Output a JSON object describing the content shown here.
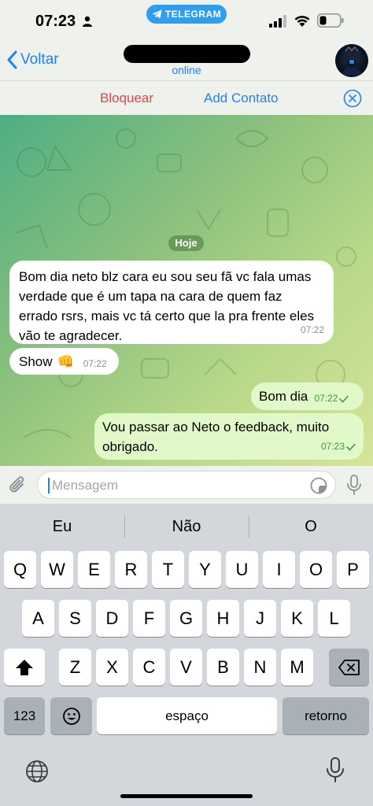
{
  "status": {
    "time": "07:23",
    "app_pill": "TELEGRAM"
  },
  "header": {
    "back_label": "Voltar",
    "status_text": "online"
  },
  "actions": {
    "block_label": "Bloquear",
    "add_contact_label": "Add Contato"
  },
  "chat": {
    "date_label": "Hoje",
    "messages": [
      {
        "text": "Bom dia neto blz cara eu sou seu fã vc fala umas verdade que é um tapa na cara de quem faz errado rsrs, mais vc tá certo que la pra frente eles vão te agradecer.",
        "time": "07:22"
      },
      {
        "text": "Show",
        "emoji": "👊",
        "time": "07:22"
      },
      {
        "text": "Bom dia",
        "time": "07:22"
      },
      {
        "text": "Vou passar ao Neto o feedback, muito obrigado.",
        "time": "07:23"
      }
    ]
  },
  "composer": {
    "placeholder": "Mensagem"
  },
  "keyboard": {
    "suggestions": [
      "Eu",
      "Não",
      "O"
    ],
    "row1": [
      "Q",
      "W",
      "E",
      "R",
      "T",
      "Y",
      "U",
      "I",
      "O",
      "P"
    ],
    "row2": [
      "A",
      "S",
      "D",
      "F",
      "G",
      "H",
      "J",
      "K",
      "L"
    ],
    "row3": [
      "Z",
      "X",
      "C",
      "V",
      "B",
      "N",
      "M"
    ],
    "numbers_label": "123",
    "space_label": "espaço",
    "return_label": "retorno"
  },
  "colors": {
    "accent": "#1a82ff",
    "danger": "#e0444a",
    "outgoing_bubble": "#e1f9c8",
    "read_check": "#3d9a44"
  }
}
